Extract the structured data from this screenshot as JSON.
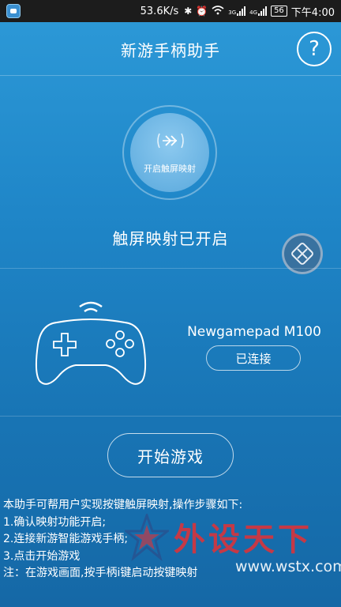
{
  "status_bar": {
    "speed": "53.6K/s",
    "network_a": "3G",
    "network_b": "4G",
    "battery": "56",
    "time": "下午4:00"
  },
  "header": {
    "title": "新游手柄助手",
    "help_label": "?"
  },
  "mapping": {
    "button_label": "开启触屏映射",
    "status_text": "触屏映射已开启"
  },
  "device": {
    "name": "Newgamepad M100",
    "status": "已连接"
  },
  "start_button_label": "开始游戏",
  "instructions": [
    "本助手可帮用户实现按键触屏映射,操作步骤如下:",
    "1.确认映射功能开启;",
    "2.连接新游智能游戏手柄;",
    "3.点击开始游戏",
    "注：在游戏画面,按手柄i键启动按键映射"
  ],
  "watermark": {
    "text": "外设天下",
    "url": "www.wstx.com"
  },
  "colors": {
    "background_top": "#2d9ad8",
    "background_bottom": "#1568a6",
    "watermark_red": "#d8343c"
  }
}
